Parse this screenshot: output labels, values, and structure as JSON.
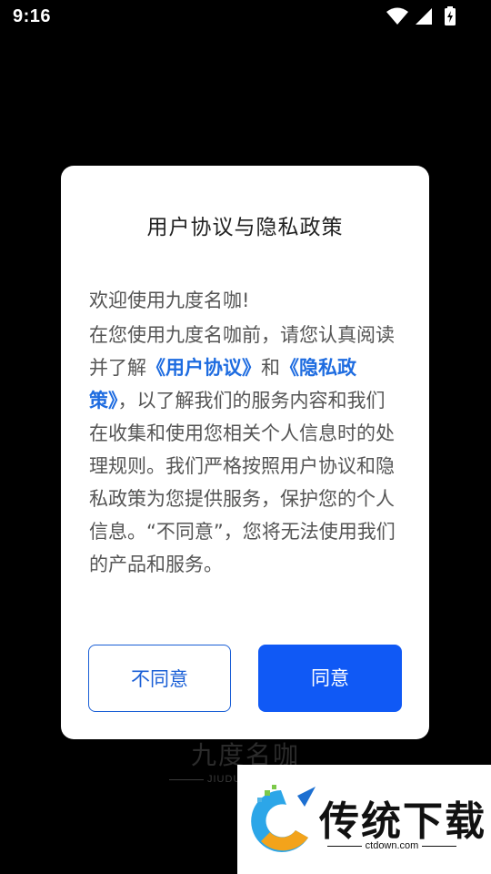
{
  "status_bar": {
    "time": "9:16",
    "icons": [
      "wifi-icon",
      "cellular-signal-icon",
      "battery-charging-icon"
    ]
  },
  "splash": {
    "logo_text": "九度名咖",
    "subtitle": "JIUDU"
  },
  "dialog": {
    "title": "用户协议与隐私政策",
    "welcome": "欢迎使用九度名咖!",
    "paragraph": {
      "part1": "在您使用九度名咖前，请您认真阅读并了解",
      "link_user_agreement": "《用户协议》",
      "conj": "和",
      "link_privacy_policy": "《隐私政策》",
      "part2": "，以了解我们的服务内容和我们在收集和使用您相关个人信息时的处理规则。我们严格按照用户协议和隐私政策为您提供服务，保护您的个人信息。“不同意”，您将无法使用我们的产品和服务。"
    },
    "buttons": {
      "disagree": "不同意",
      "agree": "同意"
    }
  },
  "watermark": {
    "title": "传统下载",
    "url": "ctdown.com"
  },
  "colors": {
    "link": "#1e6ce0",
    "primary_button": "#1059f5",
    "secondary_border": "#1a5fd6",
    "backdrop": "#000000",
    "dialog_bg": "#ffffff"
  }
}
